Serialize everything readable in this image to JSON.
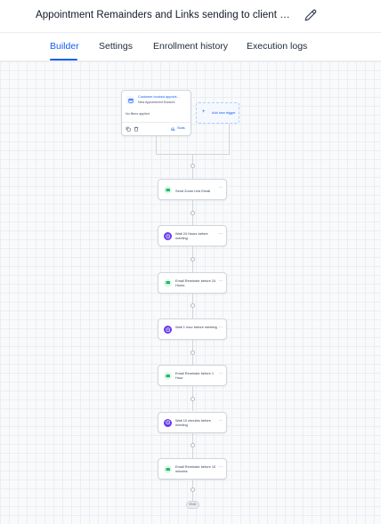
{
  "header": {
    "title": "Appointment Remainders and Links sending to client By...",
    "edit_icon": "pencil-icon"
  },
  "tabs": [
    {
      "label": "Builder",
      "active": true
    },
    {
      "label": "Settings",
      "active": false
    },
    {
      "label": "Enrollment history",
      "active": false
    },
    {
      "label": "Execution logs",
      "active": false
    }
  ],
  "colors": {
    "accent": "#155eef",
    "email_icon": "#12b76a",
    "wait_icon": "#6938ef"
  },
  "trigger": {
    "title": "Customer booked appoint...",
    "subtitle": "New Appointment Booked",
    "filter_text": "No filters applied",
    "stats_label": "Stats",
    "icon": "calendar-icon"
  },
  "add_trigger": {
    "label": "Add new trigger"
  },
  "steps": [
    {
      "type": "email",
      "icon": "mail-icon",
      "label": "Send Zoom Link Email"
    },
    {
      "type": "wait",
      "icon": "clock-icon",
      "label": "Wait 24 Hours before meeting"
    },
    {
      "type": "email",
      "icon": "mail-icon",
      "label": "Email Reminder before 24 Hours"
    },
    {
      "type": "wait",
      "icon": "clock-icon",
      "label": "Wait 1 hour before meeting"
    },
    {
      "type": "email",
      "icon": "mail-icon",
      "label": "Email Reminder before 1 Hour"
    },
    {
      "type": "wait",
      "icon": "clock-icon",
      "label": "Wait 10 minutes before meeting"
    },
    {
      "type": "email",
      "icon": "mail-icon",
      "label": "Email Reminder before 10 minutes"
    }
  ],
  "end_label": "END"
}
